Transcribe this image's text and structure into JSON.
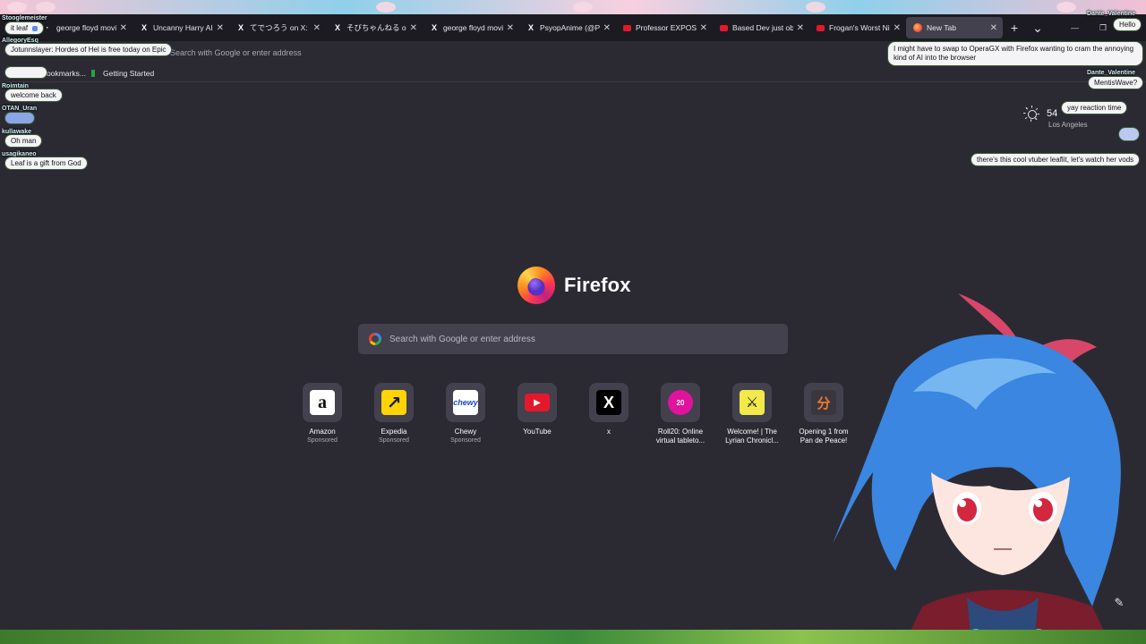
{
  "tabs": [
    {
      "title": "george floyd movie",
      "icon": "chat-icon"
    },
    {
      "title": "Uncanny Harry AI on X",
      "icon": "x-icon"
    },
    {
      "title": "てでつろう on X: \"",
      "icon": "x-icon"
    },
    {
      "title": "そびちゃんねる on X",
      "icon": "x-icon"
    },
    {
      "title": "george floyd movie",
      "icon": "x-icon"
    },
    {
      "title": "PsyopAnime (@Psyop",
      "icon": "x-icon"
    },
    {
      "title": "Professor EXPOSES",
      "icon": "youtube-icon"
    },
    {
      "title": "Based Dev just oblit",
      "icon": "youtube-icon"
    },
    {
      "title": "Frogan's Worst Nigh",
      "icon": "youtube-icon"
    },
    {
      "title": "New Tab",
      "icon": "firefox-icon",
      "active": true
    }
  ],
  "url": {
    "placeholder": "Search with Google or enter address"
  },
  "bookmarks": {
    "left": "ookmarks...",
    "getting_started": "Getting Started"
  },
  "weather": {
    "temp": "54",
    "location": "Los Angeles"
  },
  "logo": {
    "wordmark": "Firefox"
  },
  "search": {
    "placeholder": "Search with Google or enter address"
  },
  "top_sites": [
    {
      "label": "Amazon",
      "sponsored": "Sponsored",
      "glyph": "a",
      "bg": "#ffffff",
      "fg": "#111111"
    },
    {
      "label": "Expedia",
      "sponsored": "Sponsored",
      "glyph": "↗",
      "bg": "#ffd400",
      "fg": "#1a1a1a"
    },
    {
      "label": "Chewy",
      "sponsored": "Sponsored",
      "glyph": "chewy",
      "bg": "#ffffff",
      "fg": "#1c49c2"
    },
    {
      "label": "YouTube",
      "sponsored": "",
      "glyph": "▶",
      "bg": "#e4182c",
      "fg": "#ffffff"
    },
    {
      "label": "x",
      "sponsored": "",
      "glyph": "X",
      "bg": "#000000",
      "fg": "#ffffff"
    },
    {
      "label": "Roll20: Online virtual tableto...",
      "sponsored": "",
      "glyph": "20",
      "bg": "#e0139c",
      "fg": "#ffffff"
    },
    {
      "label": "Welcome! | The Lyrian Chronicl...",
      "sponsored": "",
      "glyph": "⚔",
      "bg": "#f3e94a",
      "fg": "#111111"
    },
    {
      "label": "Opening 1 from Pan de Peace!",
      "sponsored": "",
      "glyph": "分",
      "bg": "#3a3640",
      "fg": "#f07b2a"
    }
  ],
  "chat_left": [
    {
      "user": "Stooglemeister",
      "msg": "it leaf"
    },
    {
      "user": "AllegoryEsq",
      "msg": "Jotunnslayer: Hordes of Hel is free today on Epic"
    },
    {
      "user": "",
      "msg": ""
    },
    {
      "user": "Roimtain",
      "msg": "welcome back"
    },
    {
      "user": "OTAN_Uran",
      "msg": ""
    },
    {
      "user": "kullawake",
      "msg": "Oh man"
    },
    {
      "user": "usagikaneo",
      "msg": "Leaf is a gift from God"
    }
  ],
  "chat_right": [
    {
      "user": "Dante_Valentine",
      "msg": "Hello"
    },
    {
      "user": "",
      "msg": "I might have to swap to OperaGX with Firefox wanting to cram the annoying kind of AI into the browser"
    },
    {
      "user": "Dante_Valentine",
      "msg": "MentisWave?"
    },
    {
      "user": "",
      "msg": "yay reaction time"
    },
    {
      "user": "",
      "msg": "there's this cool vtuber leaflit, let's watch her vods"
    }
  ],
  "colors": {
    "bg": "#2b2a33",
    "tile": "#42414d",
    "tabstrip": "#1c1b22"
  }
}
